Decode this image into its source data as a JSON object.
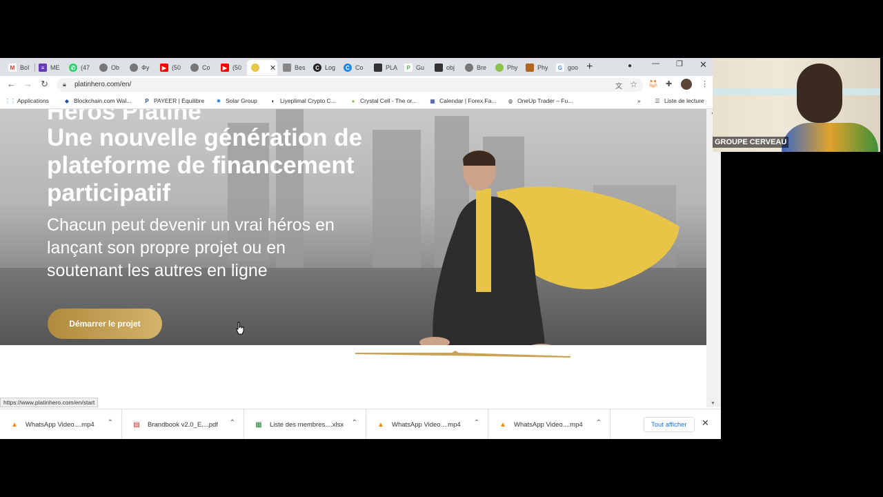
{
  "tabs": [
    {
      "label": "Boî",
      "icon": "gmail-icon",
      "color": "#d93025"
    },
    {
      "label": "ME",
      "icon": "forms-icon",
      "color": "#673ab7"
    },
    {
      "label": "(47",
      "icon": "whatsapp-icon",
      "color": "#25d366"
    },
    {
      "label": "Ob",
      "icon": "globe-icon",
      "color": "#555555"
    },
    {
      "label": "Фу",
      "icon": "globe-icon",
      "color": "#555555"
    },
    {
      "label": "(50",
      "icon": "youtube-icon",
      "color": "#ff0000"
    },
    {
      "label": "Co",
      "icon": "globe-icon",
      "color": "#555555"
    },
    {
      "label": "(50",
      "icon": "youtube-icon",
      "color": "#ff0000"
    },
    {
      "label": "",
      "icon": "platinhero-icon",
      "color": "#e8c547",
      "active": true
    },
    {
      "label": "Bes",
      "icon": "site-icon",
      "color": "#888888"
    },
    {
      "label": "Log",
      "icon": "site-icon",
      "color": "#222222"
    },
    {
      "label": "Co",
      "icon": "site-icon",
      "color": "#1e88e5"
    },
    {
      "label": "PLA",
      "icon": "site-icon",
      "color": "#333333"
    },
    {
      "label": "Gu",
      "icon": "site-icon",
      "color": "#4caf50"
    },
    {
      "label": "obj",
      "icon": "site-icon",
      "color": "#333333"
    },
    {
      "label": "Bre",
      "icon": "globe-icon",
      "color": "#555555"
    },
    {
      "label": "Phy",
      "icon": "site-icon",
      "color": "#8bc34a"
    },
    {
      "label": "Phy",
      "icon": "site-icon",
      "color": "#b5651d"
    },
    {
      "label": "goo",
      "icon": "google-icon",
      "color": "#4285f4"
    }
  ],
  "toolbar": {
    "url": "platinhero.com/en/"
  },
  "bookmarks": [
    {
      "label": "Applications",
      "icon": "apps-icon"
    },
    {
      "label": "Blockchain.com Wal...",
      "icon": "blockchain-icon"
    },
    {
      "label": "PAYEER | Équilibre",
      "icon": "payeer-icon"
    },
    {
      "label": "Solar Group",
      "icon": "solar-icon"
    },
    {
      "label": "Liyeplimal Crypto C...",
      "icon": "liyeplimal-icon"
    },
    {
      "label": "Crystal Cell - The or...",
      "icon": "crystal-icon"
    },
    {
      "label": "Calendar | Forex Fa...",
      "icon": "calendar-icon"
    },
    {
      "label": "OneUp Trader – Fu...",
      "icon": "globe-icon"
    }
  ],
  "reading_list": "Liste de lecture",
  "hero": {
    "title_cut": "Héros Platine",
    "title": "Une nouvelle génération de plateforme de financement participatif",
    "subtitle": "Chacun peut devenir un vrai héros en lançant son propre projet ou en soutenant les autres en ligne",
    "cta": "Démarrer le projet"
  },
  "status_url": "https://www.platinhero.com/en/start",
  "downloads": [
    {
      "name": "WhatsApp Video....mp4",
      "icon": "vlc-icon"
    },
    {
      "name": "Brandbook v2.0_E....pdf",
      "icon": "pdf-icon"
    },
    {
      "name": "Liste des membres....xlsx",
      "icon": "excel-icon"
    },
    {
      "name": "WhatsApp Video....mp4",
      "icon": "vlc-icon"
    },
    {
      "name": "WhatsApp Video....mp4",
      "icon": "vlc-icon"
    }
  ],
  "show_all": "Tout afficher",
  "webcam": {
    "name": "GROUPE CERVEAU"
  },
  "colors": {
    "accent_gold": "#c9a255",
    "cape_yellow": "#e8c547",
    "link_blue": "#1a73e8"
  }
}
